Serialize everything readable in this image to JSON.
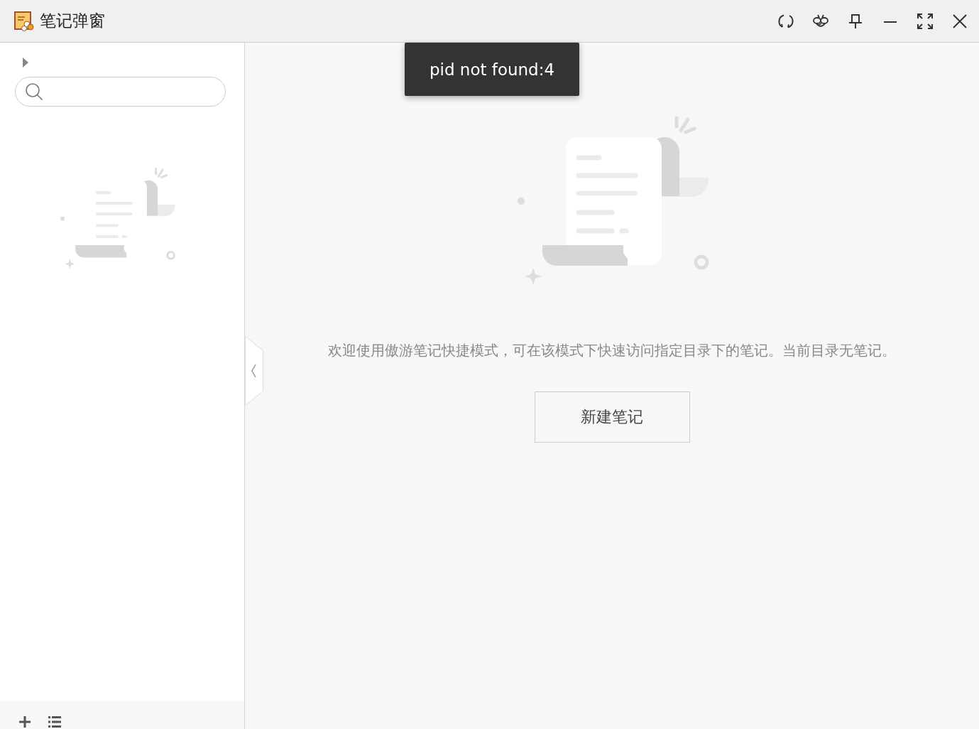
{
  "window": {
    "title": "笔记弹窗"
  },
  "toast": {
    "text": "pid not found:4"
  },
  "main": {
    "message": "欢迎使用傲游笔记快捷模式，可在该模式下快速访问指定目录下的笔记。当前目录无笔记。",
    "new_note_button": "新建笔记"
  }
}
